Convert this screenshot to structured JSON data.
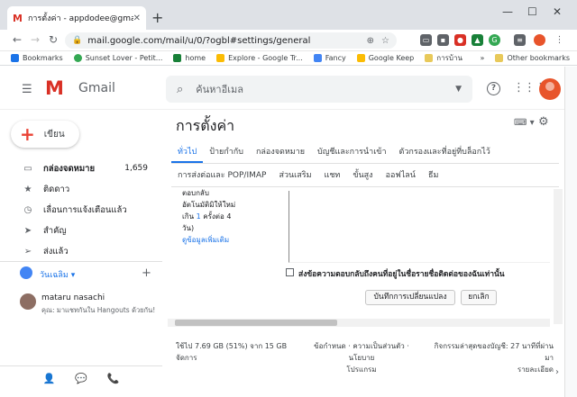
{
  "browser": {
    "tab_title": "การตั้งค่า - appdodee@gmail.com",
    "tab_favicon": "M",
    "url": "mail.google.com/mail/u/0/?ogbl#settings/general"
  },
  "bookmarks": [
    {
      "label": "Bookmarks",
      "color": "#1a73e8"
    },
    {
      "label": "Sunset Lover - Petit...",
      "color": "#34a853"
    },
    {
      "label": "home",
      "color": "#188038"
    },
    {
      "label": "Explore - Google Tr...",
      "color": "#fbbc04"
    },
    {
      "label": "Fancy",
      "color": "#4285f4"
    },
    {
      "label": "Google Keep",
      "color": "#fbbc04"
    },
    {
      "label": "การบ้าน",
      "color": "#e8c95a"
    }
  ],
  "bookmarks_more": "»",
  "other_bookmarks": "Other bookmarks",
  "gmail": {
    "logo_text": "Gmail",
    "search_placeholder": "ค้นหาอีเมล",
    "help": "?"
  },
  "compose": {
    "label": "เขียน"
  },
  "nav": [
    {
      "label": "กล่องจดหมาย",
      "count": "1,659",
      "icon": "inbox-icon",
      "glyph": "▭",
      "bold": true
    },
    {
      "label": "ติดดาว",
      "count": "",
      "icon": "star-icon",
      "glyph": "★"
    },
    {
      "label": "เลื่อนการแจ้งเตือนแล้ว",
      "count": "",
      "icon": "clock-icon",
      "glyph": "◷"
    },
    {
      "label": "สำคัญ",
      "count": "",
      "icon": "label-icon",
      "glyph": "➤"
    },
    {
      "label": "ส่งแล้ว",
      "count": "",
      "icon": "send-icon",
      "glyph": "➢"
    }
  ],
  "hangouts": {
    "user": "วันเฉลิม",
    "contact_name": "mataru nasachi",
    "contact_msg": "คุณ: มาแชทกันใน Hangouts ด้วยกัน!"
  },
  "settings": {
    "title": "การตั้งค่า",
    "tabs_row1": [
      "ทั่วไป",
      "ป้ายกำกับ",
      "กล่องจดหมาย",
      "บัญชีและการนำเข้า",
      "ตัวกรองและที่อยู่ที่บล็อกไว้"
    ],
    "tabs_row2": [
      "การส่งต่อและ POP/IMAP",
      "ส่วนเสริม",
      "แชท",
      "ขั้นสูง",
      "ออฟไลน์",
      "ธีม"
    ],
    "desc_line1": "ตอบกลับ",
    "desc_line2": "อัตโนมัติมิให้ใหม่",
    "desc_line3a": "เกิน ",
    "desc_num": "1",
    "desc_line3b": " ครั้งต่อ 4",
    "desc_line4": "วัน)",
    "desc_link": "ดูข้อมูลเพิ่มเติม",
    "checkbox_label": "ส่งข้อความตอบกลับถึงคนที่อยู่ในชื่อรายชื่อติดต่อของฉันเท่านั้น",
    "save_button": "บันทึกการเปลี่ยนแปลง",
    "cancel_button": "ยกเลิก"
  },
  "footer": {
    "storage_line1": "ใช้ไป 7.69 GB (51%) จาก 15 GB",
    "storage_line2": "จัดการ",
    "terms_line1": "ข้อกำหนด · ความเป็นส่วนตัว · นโยบาย",
    "terms_line2": "โปรแกรม",
    "activity_line1": "กิจกรรมล่าสุดของบัญชี: 27 นาทีที่ผ่าน",
    "activity_line2": "มา",
    "activity_line3": "รายละเอียด"
  }
}
